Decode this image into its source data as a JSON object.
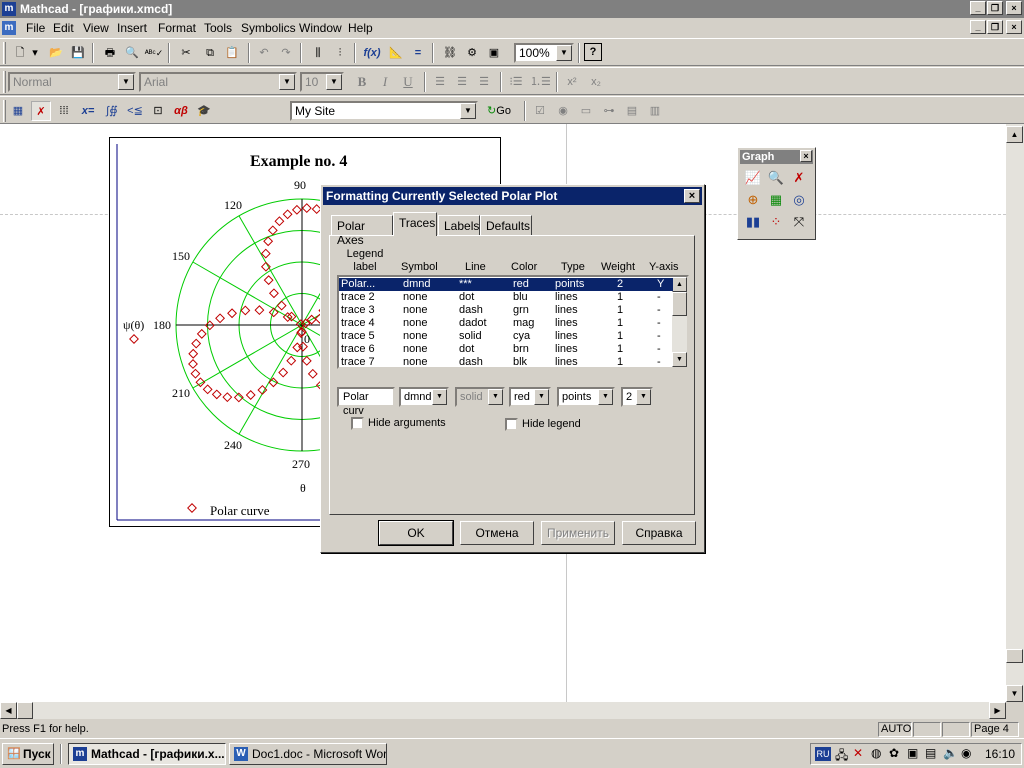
{
  "window": {
    "title": "Mathcad - [графики.xmcd]"
  },
  "menu": [
    "File",
    "Edit",
    "View",
    "Insert",
    "Format",
    "Tools",
    "Symbolics",
    "Window",
    "Help"
  ],
  "toolbar": {
    "zoom": "100%",
    "url": "My Site",
    "go": "Go"
  },
  "format_bar": {
    "style": "Normal",
    "font": "Arial",
    "size": "10",
    "bold": "B",
    "italic": "I",
    "underline": "U"
  },
  "plot": {
    "title": "Example no. 4",
    "angle_labels": {
      "a90": "90",
      "a120": "120",
      "a150": "150",
      "a180": "180",
      "a210": "210",
      "a240": "240",
      "a270": "270",
      "a0": "0"
    },
    "ylabel": "ψ(θ)",
    "xlabel": "θ",
    "legend": "Polar curve"
  },
  "graph_palette": {
    "title": "Graph"
  },
  "dialog": {
    "title": "Formatting Currently Selected Polar Plot",
    "tabs": [
      "Polar Axes",
      "Traces",
      "Labels",
      "Defaults"
    ],
    "columns": {
      "legend": "Legend label",
      "symbol": "Symbol",
      "line": "Line",
      "color": "Color",
      "type": "Type",
      "weight": "Weight",
      "yaxis": "Y-axis"
    },
    "rows": [
      {
        "label": "Polar...",
        "symbol": "dmnd",
        "line": "***",
        "color": "red",
        "type": "points",
        "weight": "2",
        "yaxis": "Y"
      },
      {
        "label": "trace 2",
        "symbol": "none",
        "line": "dot",
        "color": "blu",
        "type": "lines",
        "weight": "1",
        "yaxis": "-"
      },
      {
        "label": "trace 3",
        "symbol": "none",
        "line": "dash",
        "color": "grn",
        "type": "lines",
        "weight": "1",
        "yaxis": "-"
      },
      {
        "label": "trace 4",
        "symbol": "none",
        "line": "dadot",
        "color": "mag",
        "type": "lines",
        "weight": "1",
        "yaxis": "-"
      },
      {
        "label": "trace 5",
        "symbol": "none",
        "line": "solid",
        "color": "cya",
        "type": "lines",
        "weight": "1",
        "yaxis": "-"
      },
      {
        "label": "trace 6",
        "symbol": "none",
        "line": "dot",
        "color": "brn",
        "type": "lines",
        "weight": "1",
        "yaxis": "-"
      },
      {
        "label": "trace 7",
        "symbol": "none",
        "line": "dash",
        "color": "blk",
        "type": "lines",
        "weight": "1",
        "yaxis": "-"
      }
    ],
    "edit": {
      "label": "Polar curv",
      "symbol": "dmnd",
      "line": "solid",
      "color": "red",
      "type": "points",
      "weight": "2"
    },
    "hide_arguments": "Hide arguments",
    "hide_legend": "Hide legend",
    "buttons": {
      "ok": "OK",
      "cancel": "Отмена",
      "apply": "Применить",
      "help": "Справка"
    }
  },
  "status": {
    "help": "Press F1 for help.",
    "mode": "AUTO",
    "page": "Page 4"
  },
  "taskbar": {
    "start": "Пуск",
    "items": [
      "Mathcad - [графики.x...",
      "Doc1.doc - Microsoft Word"
    ],
    "lang": "RU",
    "clock": "16:10"
  },
  "colors": {
    "title_active": "#0a246a",
    "title_inactive": "#808080",
    "face": "#d4d0c8",
    "grid": "#00cc00",
    "trace": "#c00000",
    "axis": "#000080"
  }
}
